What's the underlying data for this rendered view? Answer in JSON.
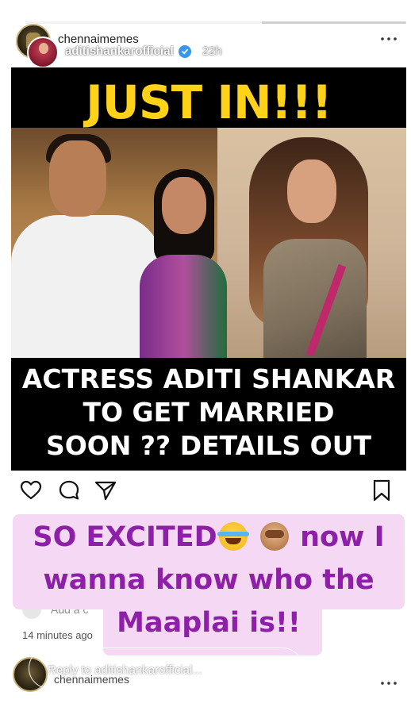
{
  "story": {
    "progress_fraction": 0.62,
    "reposted_from": "chennaimemes",
    "owner": "aditishankarofficial",
    "time": "22h",
    "icons": {
      "pause": "pause-icon",
      "mute": "speaker-muted-icon",
      "more": "more-icon",
      "verified": "verified-badge-icon"
    }
  },
  "post": {
    "headline": "JUST IN!!!",
    "caption_lines": [
      "ACTRESS ADITI SHANKAR",
      "TO GET MARRIED",
      "SOON ?? DETAILS OUT"
    ],
    "actions": [
      "heart-icon",
      "comment-icon",
      "share-icon",
      "bookmark-icon"
    ],
    "comment_placeholder": "Add a c",
    "minutes_ago": "14 minutes ago"
  },
  "sticker": {
    "line1_text": "SO EXCITED",
    "line1_suffix": "now I",
    "line2": "wanna know who the",
    "line3": "Maaplai is!!",
    "emojis": [
      "face-with-tears-of-joy",
      "see-no-evil-monkey"
    ],
    "color": "#8e1fa8",
    "background": "#f5d8f3"
  },
  "footer": {
    "account": "chennaimemes",
    "reply_placeholder": "Reply to aditishankarofficial..."
  }
}
